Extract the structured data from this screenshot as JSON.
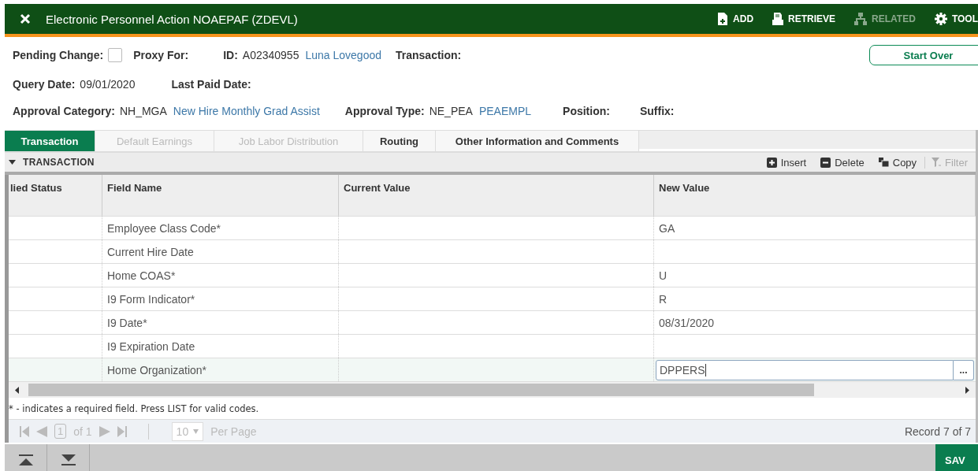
{
  "window": {
    "title": "Electronic Personnel Action NOAEPAF (ZDEVL)"
  },
  "header_actions": [
    {
      "label": "ADD",
      "disabled": false
    },
    {
      "label": "RETRIEVE",
      "disabled": false
    },
    {
      "label": "RELATED",
      "disabled": true
    },
    {
      "label": "TOOL",
      "disabled": false
    }
  ],
  "key_block": {
    "pending_change_label": "Pending Change:",
    "pending_change_checked": false,
    "proxy_for_label": "Proxy For:",
    "id_label": "ID:",
    "id_value": "A02340955",
    "id_name": "Luna Lovegood",
    "transaction_label": "Transaction:",
    "start_over": "Start Over",
    "query_date_label": "Query Date:",
    "query_date_value": "09/01/2020",
    "last_paid_label": "Last Paid Date:",
    "approval_category_label": "Approval Category:",
    "approval_category_code": "NH_MGA",
    "approval_category_desc": "New Hire Monthly Grad Assist",
    "approval_type_label": "Approval Type:",
    "approval_type_code": "NE_PEA",
    "approval_type_desc": "PEAEMPL",
    "position_label": "Position:",
    "suffix_label": "Suffix:"
  },
  "tabs": [
    {
      "label": "Transaction",
      "selected": true,
      "disabled": false
    },
    {
      "label": "Default Earnings",
      "selected": false,
      "disabled": true
    },
    {
      "label": "Job Labor Distribution",
      "selected": false,
      "disabled": true
    },
    {
      "label": "Routing",
      "selected": false,
      "disabled": false
    },
    {
      "label": "Other Information and Comments",
      "selected": false,
      "disabled": false
    }
  ],
  "section": {
    "title": "TRANSACTION",
    "expanded": true,
    "tools": [
      {
        "label": "Insert",
        "disabled": false
      },
      {
        "label": "Delete",
        "disabled": false
      },
      {
        "label": "Copy",
        "disabled": false
      },
      {
        "label": "Filter",
        "disabled": true
      }
    ]
  },
  "table": {
    "columns": [
      "lied Status",
      "Field Name",
      "Current Value",
      "New Value"
    ],
    "rows": [
      {
        "status": "",
        "field": "Employee Class Code*",
        "current": "",
        "new": "GA",
        "selected": false
      },
      {
        "status": "",
        "field": "Current Hire Date",
        "current": "",
        "new": "",
        "selected": false
      },
      {
        "status": "",
        "field": "Home COAS*",
        "current": "",
        "new": "U",
        "selected": false
      },
      {
        "status": "",
        "field": "I9 Form Indicator*",
        "current": "",
        "new": "R",
        "selected": false
      },
      {
        "status": "",
        "field": "I9 Date*",
        "current": "",
        "new": "08/31/2020",
        "selected": false
      },
      {
        "status": "",
        "field": "I9 Expiration Date",
        "current": "",
        "new": "",
        "selected": false
      },
      {
        "status": "",
        "field": "Home Organization*",
        "current": "",
        "new": "DPPERS",
        "selected": true,
        "lookup": "..."
      }
    ]
  },
  "note": "* - indicates a required field. Press LIST for valid codes.",
  "pager": {
    "page": "1",
    "of": "of 1",
    "per_page": "10",
    "per_page_label": "Per Page",
    "record": "Record 7 of 7"
  },
  "footer": {
    "save": "SAV"
  }
}
